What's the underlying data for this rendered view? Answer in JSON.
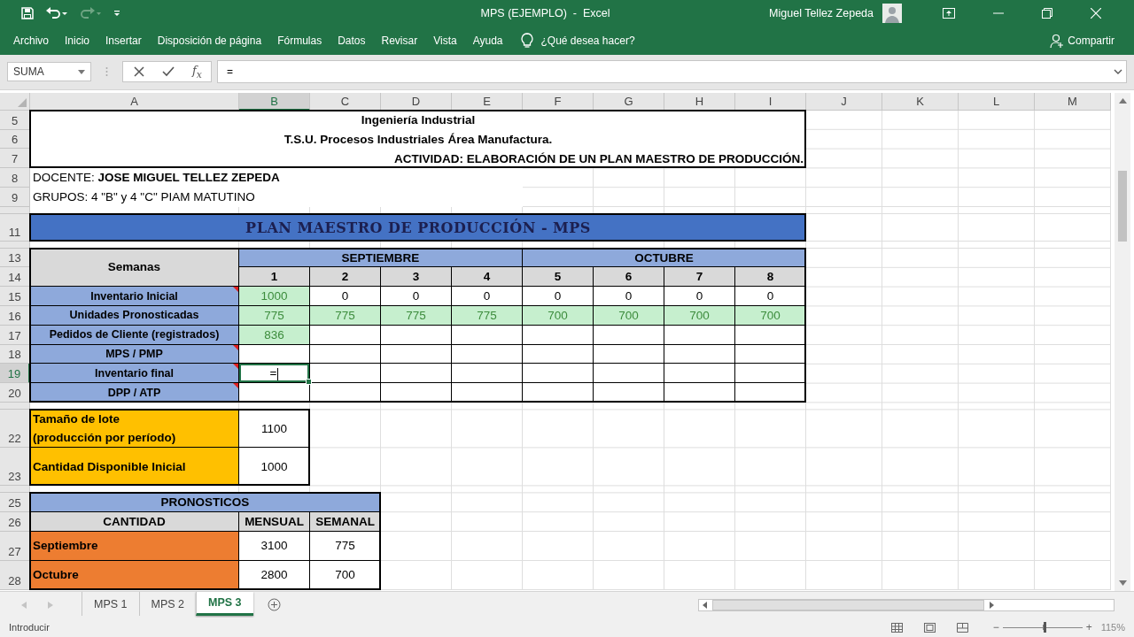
{
  "title_bar": {
    "quick_access": [
      {
        "kind": "save",
        "disabled": false
      },
      {
        "kind": "undo",
        "disabled": false
      },
      {
        "kind": "redo",
        "disabled": true
      },
      {
        "kind": "customize",
        "disabled": false
      }
    ],
    "title": "MPS (EJEMPLO)  -  Excel",
    "user": "Miguel Tellez Zepeda"
  },
  "ribbon_tabs": [
    {
      "label": "Archivo"
    },
    {
      "label": "Inicio"
    },
    {
      "label": "Insertar"
    },
    {
      "label": "Disposición de página"
    },
    {
      "label": "Fórmulas"
    },
    {
      "label": "Datos"
    },
    {
      "label": "Revisar"
    },
    {
      "label": "Vista"
    },
    {
      "label": "Ayuda"
    }
  ],
  "tell_me": "¿Qué desea hacer?",
  "share": "Compartir",
  "formula_bar": {
    "name_box": "SUMA",
    "function_label": "f$_{x}$",
    "value": "="
  },
  "sheet": {
    "columns": [
      {
        "label": "A",
        "selected": false
      },
      {
        "label": "B",
        "selected": true
      },
      {
        "label": "C",
        "selected": false
      },
      {
        "label": "D",
        "selected": false
      },
      {
        "label": "E",
        "selected": false
      },
      {
        "label": "F",
        "selected": false
      },
      {
        "label": "G",
        "selected": false
      },
      {
        "label": "H",
        "selected": false
      },
      {
        "label": "I",
        "selected": false
      },
      {
        "label": "J",
        "selected": false
      },
      {
        "label": "K",
        "selected": false
      },
      {
        "label": "L",
        "selected": false
      },
      {
        "label": "M",
        "selected": false
      }
    ],
    "rows": [
      {
        "label": "5",
        "selected": false
      },
      {
        "label": "6",
        "selected": false
      },
      {
        "label": "7",
        "selected": false
      },
      {
        "label": "8",
        "selected": false
      },
      {
        "label": "9",
        "selected": false
      },
      {
        "selected": false
      },
      {
        "label": "11",
        "selected": false
      },
      {
        "selected": false
      },
      {
        "label": "13",
        "selected": false
      },
      {
        "label": "14",
        "selected": false
      },
      {
        "label": "15",
        "selected": false
      },
      {
        "label": "16",
        "selected": false
      },
      {
        "label": "17",
        "selected": false
      },
      {
        "label": "18",
        "selected": false
      },
      {
        "label": "19",
        "selected": true
      },
      {
        "label": "20",
        "selected": false
      },
      {
        "selected": false
      },
      {
        "label": "22",
        "selected": false
      },
      {
        "label": "23",
        "selected": false
      },
      {
        "selected": false
      },
      {
        "label": "25",
        "selected": false
      },
      {
        "label": "26",
        "selected": false
      },
      {
        "label": "27",
        "selected": false
      },
      {
        "label": "28",
        "selected": false
      }
    ],
    "cells": [
      {
        "kind": "title",
        "text": "Ingeniería Industrial",
        "selected": false
      },
      {
        "kind": "title",
        "text": "T.S.U. Procesos Industriales Área Manufactura.",
        "selected": false
      },
      {
        "kind": "title",
        "text": "ACTIVIDAD: ELABORACIÓN DE UN PLAN MAESTRO DE PRODUCCIÓN.",
        "selected": false
      },
      {
        "kind": "note",
        "text": "DOCENTE: **JOSE MIGUEL TELLEZ ZEPEDA**",
        "selected": false
      },
      {
        "kind": "note",
        "text": "GRUPOS: 4 \"B\" y 4 \"C\" PIAM MATUTINO",
        "selected": false
      },
      {
        "kind": "banner",
        "text": "PLAN MAESTRO DE PRODUCCIÓN - MPS",
        "selected": false
      },
      {
        "kind": "header",
        "text": "Semanas",
        "selected": false
      },
      {
        "kind": "band",
        "text": "SEPTIEMBRE",
        "selected": false
      },
      {
        "kind": "band",
        "text": "OCTUBRE",
        "selected": false
      },
      {
        "kind": "header",
        "text": "1",
        "selected": false
      },
      {
        "kind": "header",
        "text": "2",
        "selected": false
      },
      {
        "kind": "header",
        "text": "3",
        "selected": false
      },
      {
        "kind": "header",
        "text": "4",
        "selected": false
      },
      {
        "kind": "header",
        "text": "5",
        "selected": false
      },
      {
        "kind": "header",
        "text": "6",
        "selected": false
      },
      {
        "kind": "header",
        "text": "7",
        "selected": false
      },
      {
        "kind": "header",
        "text": "8",
        "selected": false
      },
      {
        "kind": "label",
        "text": "Inventario Inicial",
        "comment": true,
        "selected": false
      },
      {
        "kind": "green",
        "text": "1000",
        "selected": false
      },
      {
        "kind": "value",
        "text": "0",
        "selected": false
      },
      {
        "kind": "value",
        "text": "0",
        "selected": false
      },
      {
        "kind": "value",
        "text": "0",
        "selected": false
      },
      {
        "kind": "value",
        "text": "0",
        "selected": false
      },
      {
        "kind": "value",
        "text": "0",
        "selected": false
      },
      {
        "kind": "value",
        "text": "0",
        "selected": false
      },
      {
        "kind": "value",
        "text": "0",
        "selected": false
      },
      {
        "kind": "label",
        "text": "Unidades Pronosticadas",
        "comment": false,
        "selected": false
      },
      {
        "kind": "green",
        "text": "775",
        "selected": false
      },
      {
        "kind": "green",
        "text": "775",
        "selected": false
      },
      {
        "kind": "green",
        "text": "775",
        "selected": false
      },
      {
        "kind": "green",
        "text": "775",
        "selected": false
      },
      {
        "kind": "green",
        "text": "700",
        "selected": false
      },
      {
        "kind": "green",
        "text": "700",
        "selected": false
      },
      {
        "kind": "green",
        "text": "700",
        "selected": false
      },
      {
        "kind": "green",
        "text": "700",
        "selected": false
      },
      {
        "kind": "label",
        "text": "Pedidos de Cliente (registrados)",
        "comment": false,
        "selected": false
      },
      {
        "kind": "green",
        "text": "836",
        "selected": false
      },
      {
        "kind": "label",
        "text": "MPS / PMP",
        "comment": true,
        "selected": false
      },
      {
        "kind": "label",
        "text": "Inventario final",
        "comment": true,
        "selected": false
      },
      {
        "kind": "value",
        "text": "=",
        "selected": true
      },
      {
        "kind": "label",
        "text": "DPP / ATP",
        "comment": true,
        "selected": false
      },
      {
        "kind": "yellow",
        "text": "Tamaño de lote\n(producción por período)",
        "selected": false
      },
      {
        "kind": "value",
        "text": "1100",
        "selected": false
      },
      {
        "kind": "yellow",
        "text": "Cantidad Disponible Inicial",
        "selected": false
      },
      {
        "kind": "value",
        "text": "1000",
        "selected": false
      },
      {
        "kind": "band",
        "text": "PRONOSTICOS",
        "selected": false
      },
      {
        "kind": "header",
        "text": "CANTIDAD",
        "selected": false
      },
      {
        "kind": "header",
        "text": "MENSUAL",
        "selected": false
      },
      {
        "kind": "header",
        "text": "SEMANAL",
        "selected": false
      },
      {
        "kind": "orange",
        "text": "Septiembre",
        "selected": false
      },
      {
        "kind": "value",
        "text": "3100",
        "selected": false
      },
      {
        "kind": "value",
        "text": "775",
        "selected": false
      },
      {
        "kind": "orange",
        "text": "Octubre",
        "selected": false
      },
      {
        "kind": "value",
        "text": "2800",
        "selected": false
      },
      {
        "kind": "value",
        "text": "700",
        "selected": false
      }
    ]
  },
  "sheet_tabs": [
    {
      "label": "MPS 1",
      "selected": false
    },
    {
      "label": "MPS 2",
      "selected": false
    },
    {
      "label": "MPS 3",
      "selected": true
    }
  ],
  "status_bar": {
    "mode": "Introducir",
    "zoom": {
      "out": "−",
      "in": "+",
      "level": 0.53,
      "reading": "115%"
    }
  }
}
